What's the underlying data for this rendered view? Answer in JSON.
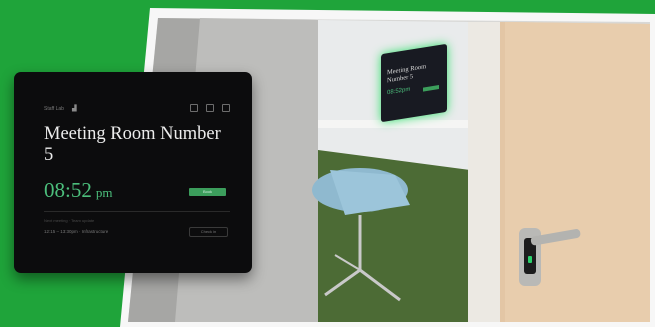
{
  "tablet": {
    "location": "Staff Lab",
    "room_title": "Meeting Room Number 5",
    "time": "08:52",
    "ampm": "pm",
    "book_label": "Book",
    "next_label": "Next meeting · Team update",
    "next_meeting": "12:15 – 13:30pm · Infrastructure",
    "checkin_label": "Check in"
  },
  "mini_tablet": {
    "room_title": "Meeting Room Number 5",
    "time": "08:52pm"
  },
  "colors": {
    "background_green": "#1fa43a",
    "accent_green": "#4cbf7c",
    "button_green": "#3c9e5c",
    "tablet_body": "#0c0c0d"
  }
}
